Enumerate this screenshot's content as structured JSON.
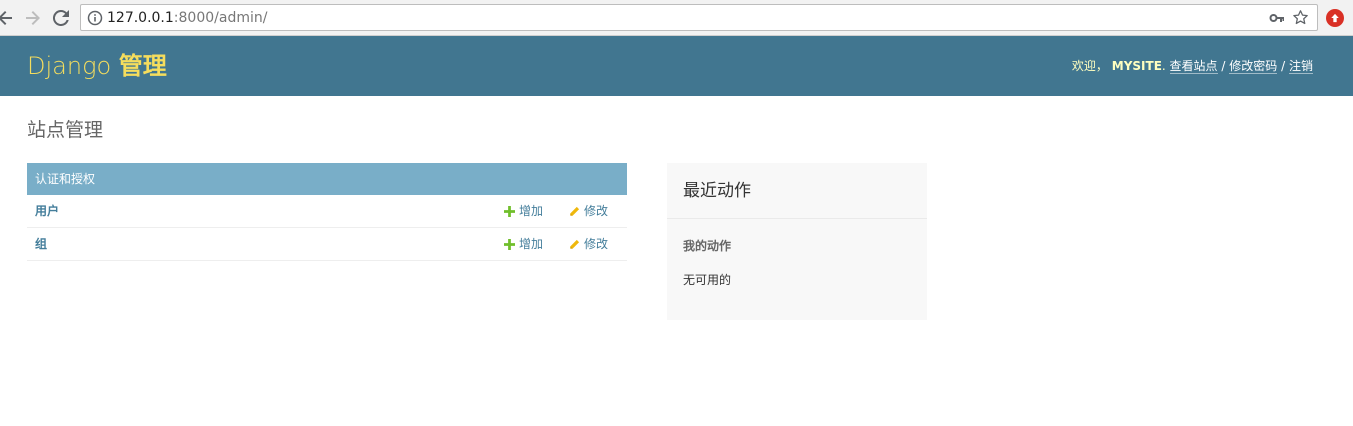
{
  "browser": {
    "url_host": "127.0.0.1",
    "url_rest": ":8000/admin/",
    "icons": [
      "back-arrow-icon",
      "forward-arrow-icon",
      "reload-icon",
      "info-icon",
      "key-icon",
      "star-icon",
      "extension-icon"
    ]
  },
  "header": {
    "brand_django": "Django",
    "brand_admin": "管理",
    "welcome": "欢迎，",
    "username": "MYSITE",
    "period": ".",
    "view_site": "查看站点",
    "separator": "/",
    "change_password": "修改密码",
    "logout": "注销"
  },
  "main": {
    "title": "站点管理",
    "module": {
      "caption": "认证和授权",
      "rows": [
        {
          "name": "用户",
          "add": "增加",
          "change": "修改"
        },
        {
          "name": "组",
          "add": "增加",
          "change": "修改"
        }
      ]
    }
  },
  "recent": {
    "title": "最近动作",
    "subtitle": "我的动作",
    "empty": "无可用的"
  },
  "colors": {
    "header_bg": "#417690",
    "brand": "#f5dd5d",
    "caption_bg": "#79aec8",
    "link": "#447e9b",
    "add_icon": "#70bf2b",
    "change_icon": "#efb80b"
  }
}
